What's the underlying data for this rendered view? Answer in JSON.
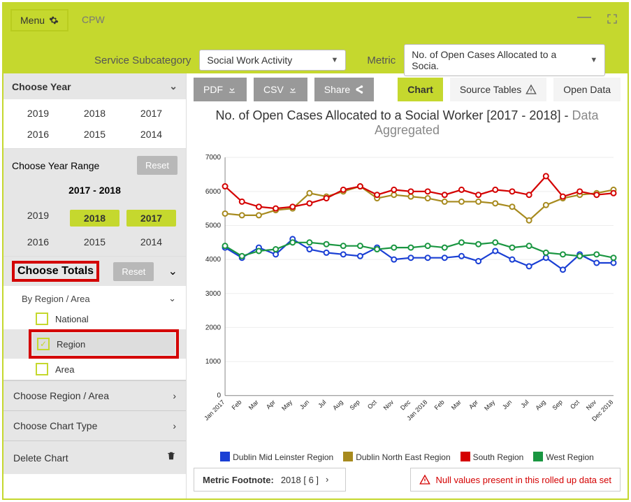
{
  "header": {
    "menu_label": "Menu",
    "app_title": "CPW",
    "service_label": "Service Subcategory",
    "service_value": "Social Work Activity",
    "metric_label": "Metric",
    "metric_value": "No. of Open Cases Allocated to a Socia."
  },
  "sidebar": {
    "choose_year_label": "Choose Year",
    "years": [
      "2019",
      "2018",
      "2017",
      "2016",
      "2015",
      "2014"
    ],
    "range_label": "Choose Year Range",
    "reset_label": "Reset",
    "range_value": "2017 - 2018",
    "range_years": [
      "2019",
      "2018",
      "2017",
      "2016",
      "2015",
      "2014"
    ],
    "range_selected": [
      "2018",
      "2017"
    ],
    "totals_label": "Choose Totals",
    "by_region_label": "By Region / Area",
    "totals_opts": {
      "national": "National",
      "region": "Region",
      "area": "Area"
    },
    "choose_region_label": "Choose Region / Area",
    "choose_chart_label": "Choose Chart Type",
    "delete_chart_label": "Delete Chart"
  },
  "toolbar": {
    "pdf": "PDF",
    "csv": "CSV",
    "share": "Share",
    "chart": "Chart",
    "source": "Source Tables",
    "open_data": "Open Data"
  },
  "chart_title": {
    "main": "No. of Open Cases Allocated to a Social Worker [2017 - 2018] - ",
    "suffix": "Data Aggregated"
  },
  "legend": {
    "s1": "Dublin Mid Leinster Region",
    "s2": "Dublin North East Region",
    "s3": "South Region",
    "s4": "West Region"
  },
  "colors": {
    "s1": "#1a3fd4",
    "s2": "#a78a1e",
    "s3": "#d40000",
    "s4": "#1a9641"
  },
  "footer": {
    "footnote_label": "Metric Footnote:",
    "footnote_value": "2018 [ 6 ]",
    "warning": "Null values present in this rolled up data set"
  },
  "chart_data": {
    "type": "line",
    "xlabel": "",
    "ylabel": "",
    "ylim": [
      0,
      7000
    ],
    "yticks": [
      0,
      1000,
      2000,
      3000,
      4000,
      5000,
      6000,
      7000
    ],
    "categories": [
      "Jan 2017",
      "Feb",
      "Mar",
      "Apr",
      "May",
      "Jun",
      "Jul",
      "Aug",
      "Sep",
      "Oct",
      "Nov",
      "Dec",
      "Jan 2018",
      "Feb",
      "Mar",
      "Apr",
      "May",
      "Jun",
      "Jul",
      "Aug",
      "Sep",
      "Oct",
      "Nov",
      "Dec 2018"
    ],
    "series": [
      {
        "name": "Dublin Mid Leinster Region",
        "color": "s1",
        "values": [
          4350,
          4050,
          4350,
          4150,
          4600,
          4300,
          4200,
          4150,
          4100,
          4350,
          4000,
          4050,
          4050,
          4050,
          4100,
          3950,
          4250,
          4000,
          3800,
          4050,
          3700,
          4150,
          3900,
          3900
        ]
      },
      {
        "name": "Dublin North East Region",
        "color": "s2",
        "values": [
          5350,
          5300,
          5300,
          5450,
          5500,
          5950,
          5850,
          6000,
          6150,
          5800,
          5900,
          5850,
          5800,
          5700,
          5700,
          5700,
          5650,
          5550,
          5150,
          5600,
          5800,
          5900,
          5950,
          6050
        ]
      },
      {
        "name": "South Region",
        "color": "s3",
        "values": [
          6150,
          5700,
          5550,
          5500,
          5550,
          5650,
          5800,
          6050,
          6150,
          5900,
          6050,
          6000,
          6000,
          5900,
          6050,
          5900,
          6050,
          6000,
          5900,
          6450,
          5850,
          6000,
          5900,
          5950
        ]
      },
      {
        "name": "West Region",
        "color": "s4",
        "values": [
          4400,
          4100,
          4250,
          4300,
          4500,
          4500,
          4450,
          4400,
          4400,
          4300,
          4350,
          4350,
          4400,
          4350,
          4500,
          4450,
          4500,
          4350,
          4400,
          4200,
          4150,
          4100,
          4150,
          4050
        ]
      }
    ]
  }
}
